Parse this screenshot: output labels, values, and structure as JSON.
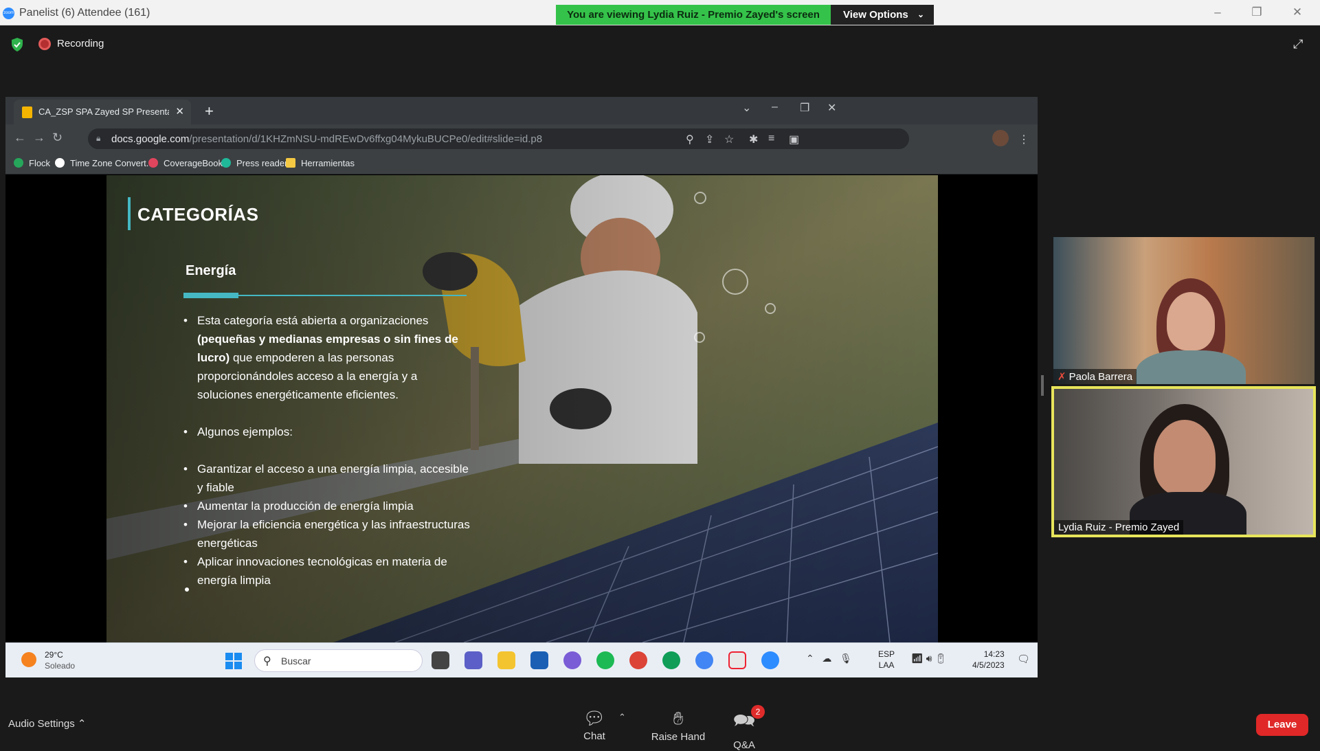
{
  "zoom": {
    "window_title": "Panelist (6) Attendee (161)",
    "logo_text": "zoom",
    "viewing_banner": "You are viewing Lydia Ruiz - Premio Zayed's screen",
    "view_options": "View Options",
    "recording": "Recording",
    "audio_settings": "Audio Settings",
    "controls": [
      {
        "label": "Chat",
        "icon": "chat-icon"
      },
      {
        "label": "Raise Hand",
        "icon": "hand-icon"
      },
      {
        "label": "Q&A",
        "icon": "qa-icon",
        "badge": "2"
      }
    ],
    "leave": "Leave"
  },
  "browser": {
    "tab_title": "CA_ZSP SPA Zayed SP Presentati",
    "url_domain": "docs.google.com",
    "url_path": "/presentation/d/1KHZmNSU-mdREwDv6ffxg04MykuBUCPe0/edit#slide=id.p8",
    "bookmarks": [
      {
        "label": "Flock",
        "color": "#26a65b"
      },
      {
        "label": "Time Zone Convert...",
        "color": "#ffffff"
      },
      {
        "label": "CoverageBook",
        "color": "#e0455e"
      },
      {
        "label": "Press reader",
        "color": "#1fb99a"
      },
      {
        "label": "Herramientas",
        "color": "#f4c842"
      }
    ]
  },
  "slide": {
    "title": "CATEGORÍAS",
    "subtitle": "Energía",
    "b1_pre": "Esta categoría está abierta a organizaciones ",
    "b1_bold": "(pequeñas y medianas empresas o sin fines de lucro)",
    "b1_post": " que empoderen a las personas proporcionándoles acceso a la energía y a soluciones energéticamente eficientes.",
    "b2": "Algunos ejemplos:",
    "examples": [
      "Garantizar el acceso a una energía limpia, accesible y fiable",
      "Aumentar la producción de energía limpia",
      "Mejorar la eficiencia energética y las infraestructuras energéticas",
      "Aplicar innovaciones tecnológicas en materia de energía limpia"
    ],
    "accent_color": "#45b8c4"
  },
  "taskbar": {
    "temp": "29°C",
    "weather": "Soleado",
    "search_placeholder": "Buscar",
    "lang_top": "ESP",
    "lang_bottom": "LAA",
    "time": "14:23",
    "date": "4/5/2023"
  },
  "participants": [
    {
      "name": "Paola Barrera",
      "muted": true
    },
    {
      "name": "Lydia Ruiz - Premio Zayed",
      "muted": false,
      "active_speaker": true
    }
  ]
}
